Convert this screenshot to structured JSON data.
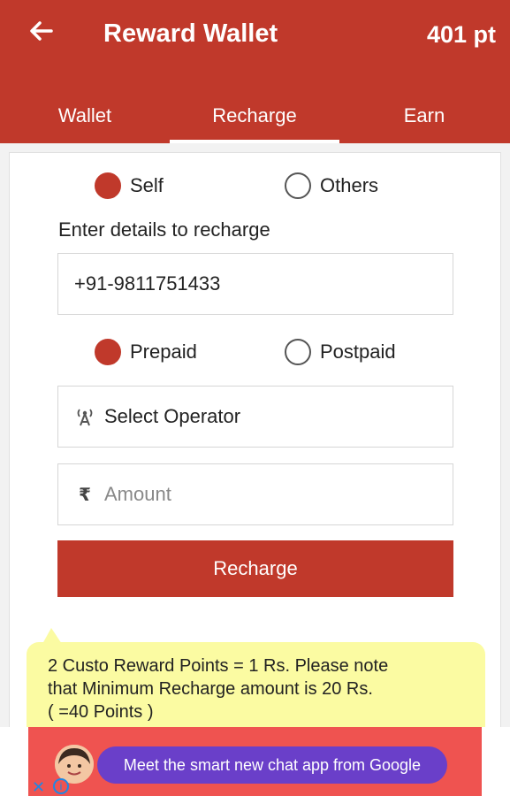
{
  "header": {
    "title": "Reward Wallet",
    "points": "401 pt"
  },
  "tabs": [
    {
      "label": "Wallet"
    },
    {
      "label": "Recharge"
    },
    {
      "label": "Earn"
    }
  ],
  "recipient": {
    "self_label": "Self",
    "others_label": "Others",
    "selected": "Self"
  },
  "form": {
    "hint": "Enter details to recharge",
    "phone_value": "+91-9811751433",
    "plan_prepaid_label": "Prepaid",
    "plan_postpaid_label": "Postpaid",
    "plan_selected": "Prepaid",
    "operator_label": "Select Operator",
    "amount_placeholder": "Amount",
    "rupee_symbol": "₹",
    "submit_label": "Recharge"
  },
  "tooltip": {
    "line1": "2 Custo Reward Points = 1 Rs. Please note",
    "line2": "that Minimum Recharge amount is 20 Rs.",
    "line3": "( =40 Points )"
  },
  "ad": {
    "text": "Meet the smart new chat app from Google",
    "close_symbol": "✕",
    "info_symbol": "i"
  },
  "colors": {
    "primary": "#c0392b",
    "tooltip_bg": "#fbfba2",
    "ad_bg": "#ef5350",
    "ad_pill": "#6a3fc9"
  },
  "icons": {
    "back": "arrow-left-icon",
    "operator": "signal-tower-icon",
    "amount": "rupee-icon",
    "ad_close": "close-icon",
    "ad_info": "info-icon"
  }
}
